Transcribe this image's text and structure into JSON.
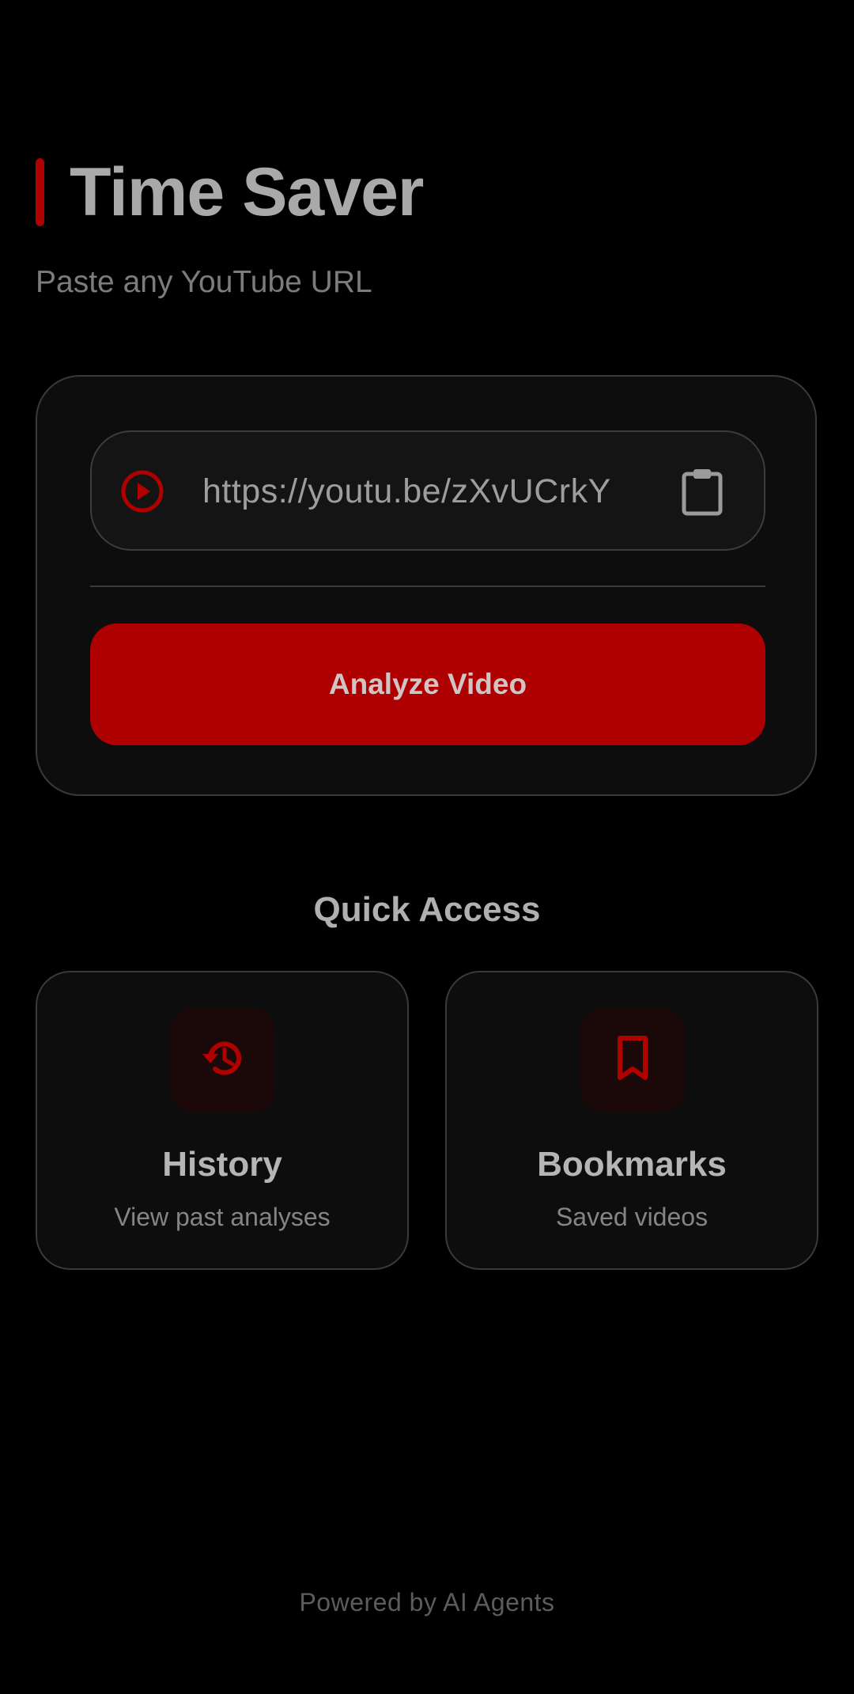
{
  "app": {
    "title": "Time Saver",
    "subtitle": "Paste any YouTube URL"
  },
  "url_input": {
    "value": "https://youtu.be/zXvUCrkY",
    "leading_icon": "play-circle-icon",
    "trailing_icon": "clipboard-paste-icon"
  },
  "actions": {
    "analyze_label": "Analyze Video"
  },
  "quick_access": {
    "title": "Quick Access",
    "items": [
      {
        "title": "History",
        "subtitle": "View past analyses",
        "icon": "history-icon"
      },
      {
        "title": "Bookmarks",
        "subtitle": "Saved videos",
        "icon": "bookmark-icon"
      }
    ]
  },
  "footer": {
    "text": "Powered by AI Agents"
  },
  "colors": {
    "accent": "#b00000",
    "background": "#000000",
    "card": "#0d0d0d",
    "border": "#3a3a3a"
  }
}
